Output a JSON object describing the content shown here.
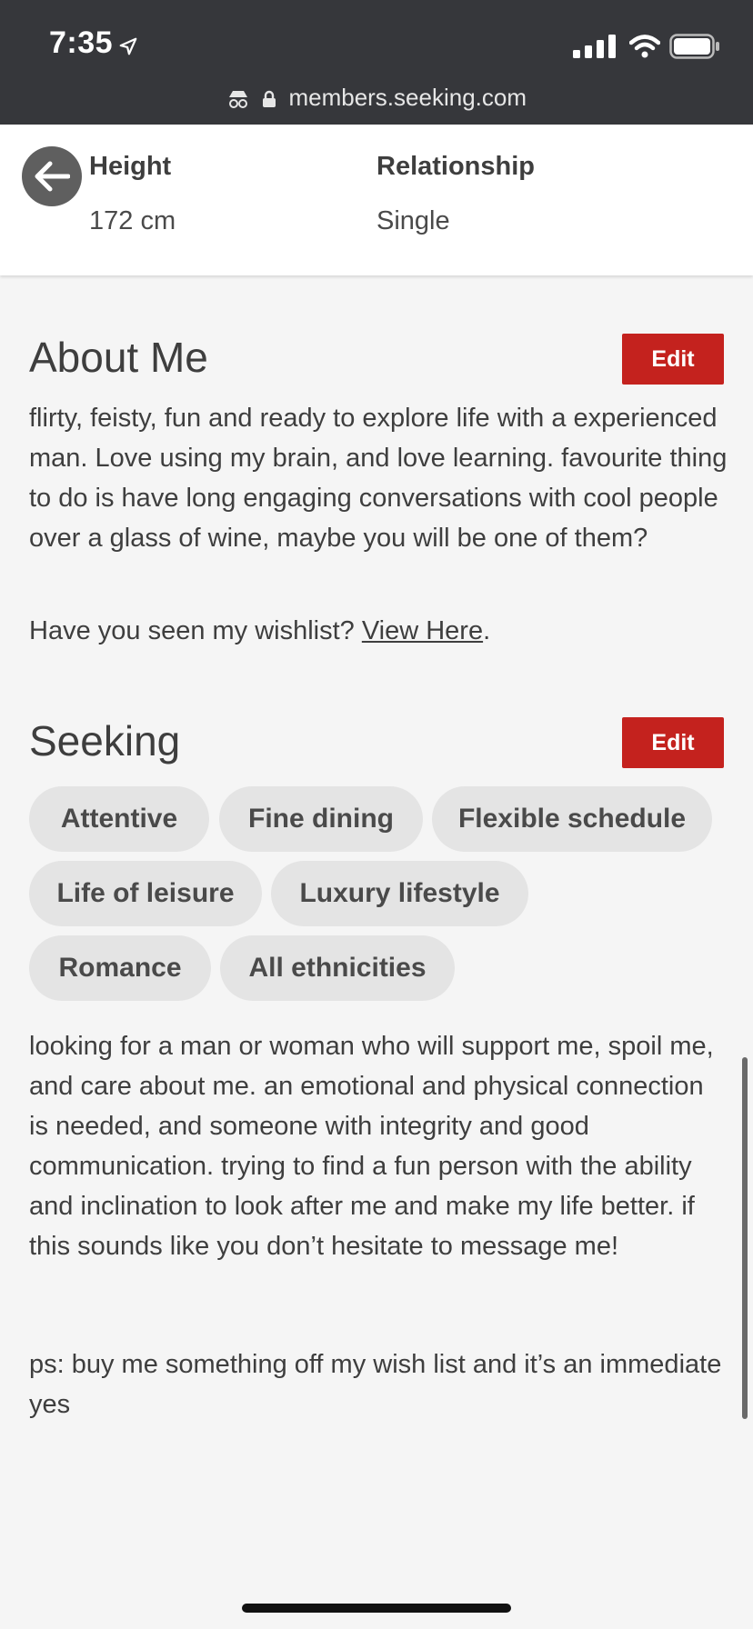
{
  "status_bar": {
    "time": "7:35",
    "location_icon": "location-arrow-icon"
  },
  "browser": {
    "url": "members.seeking.com"
  },
  "profile_stats": [
    {
      "label": "Height",
      "value": "172 cm"
    },
    {
      "label": "Relationship",
      "value": "Single"
    }
  ],
  "about": {
    "title": "About Me",
    "edit_label": "Edit",
    "text": "flirty, feisty, fun and ready to explore life with a experienced man. Love using my brain, and love learning. favourite thing to do is have long engaging conversations with cool people over a glass of wine, maybe you will be one of them?",
    "wishlist_prefix": "Have you seen my wishlist?",
    "wishlist_link": "View Here",
    "wishlist_suffix": "."
  },
  "seeking": {
    "title": "Seeking",
    "edit_label": "Edit",
    "tags": [
      "Attentive",
      "Fine dining",
      "Flexible schedule",
      "Life of leisure",
      "Luxury lifestyle",
      "Romance",
      "All ethnicities"
    ],
    "text": "looking for a man or woman who will support me, spoil me, and care about me. an emotional and physical connection is needed, and someone with integrity and good communication. trying to find a fun person with the ability and inclination to look after me and make my life better. if this sounds like you don’t hesitate to message me!",
    "ps": "ps: buy me something off my wish list and it’s an immediate yes"
  },
  "colors": {
    "accent": "#c4221e",
    "topbar": "#36373b",
    "chip": "#e4e4e4"
  }
}
